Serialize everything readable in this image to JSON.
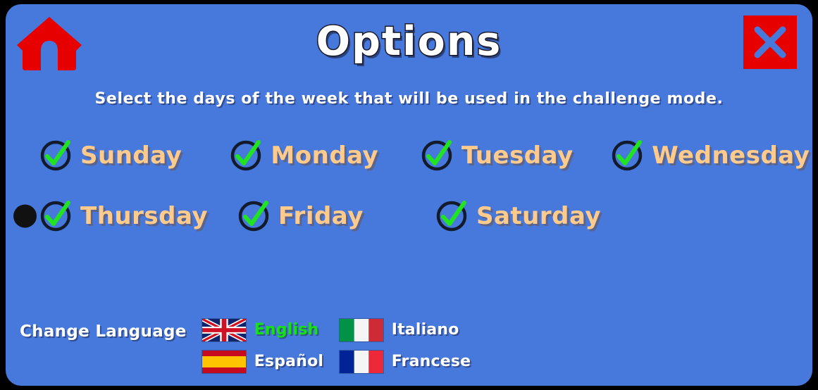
{
  "header": {
    "title": "Options",
    "home_icon": "home-icon",
    "close_icon": "close-x-icon"
  },
  "subtitle": "Select the days of the week that will be used in the challenge mode.",
  "days": {
    "rows": [
      [
        {
          "label": "Sunday",
          "checked": true,
          "cursor": false
        },
        {
          "label": "Monday",
          "checked": true,
          "cursor": false
        },
        {
          "label": "Tuesday",
          "checked": true,
          "cursor": false
        },
        {
          "label": "Wednesday",
          "checked": true,
          "cursor": false
        }
      ],
      [
        {
          "label": "Thursday",
          "checked": true,
          "cursor": true
        },
        {
          "label": "Friday",
          "checked": true,
          "cursor": false
        },
        {
          "label": "Saturday",
          "checked": true,
          "cursor": false
        }
      ]
    ]
  },
  "language": {
    "label": "Change Language",
    "options": [
      {
        "name": "English",
        "flag": "flag-uk",
        "selected": true
      },
      {
        "name": "Italiano",
        "flag": "flag-italy",
        "selected": false
      },
      {
        "name": "Español",
        "flag": "flag-spain",
        "selected": false
      },
      {
        "name": "Francese",
        "flag": "flag-france",
        "selected": false
      }
    ]
  },
  "colors": {
    "panel_background": "#4779DC",
    "title_text": "#ffffff",
    "day_label": "#FFCB8C",
    "check_green": "#22E322",
    "check_ring": "#121A2B",
    "close_button": "#E60000",
    "home_icon": "#E60000",
    "selected_language": "#16E016",
    "cursor_dot": "#111111"
  }
}
